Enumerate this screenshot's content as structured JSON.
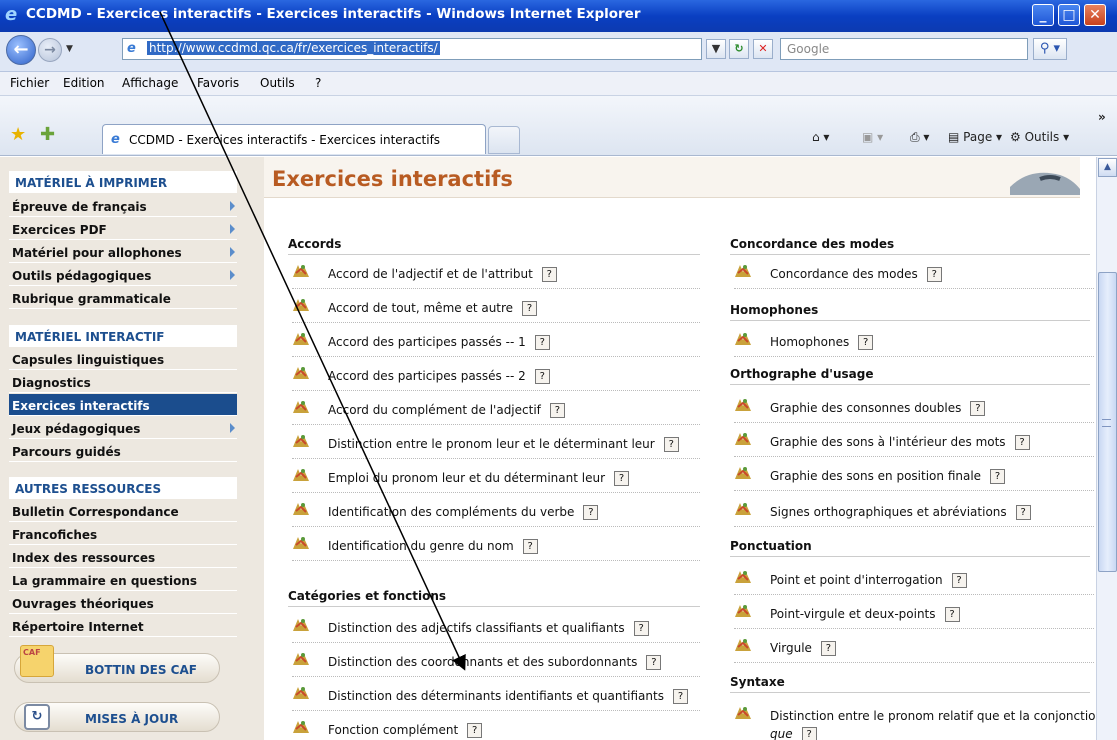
{
  "window": {
    "title": "CCDMD - Exercices interactifs - Exercices interactifs - Windows Internet Explorer"
  },
  "address": {
    "url": "http://www.ccdmd.qc.ca/fr/exercices_interactifs/",
    "search_placeholder": "Google"
  },
  "menu": [
    "Fichier",
    "Edition",
    "Affichage",
    "Favoris",
    "Outils",
    "?"
  ],
  "tab": {
    "title": "CCDMD - Exercices interactifs - Exercices interactifs"
  },
  "commands": {
    "page": "Page",
    "tools": "Outils",
    "more": "»"
  },
  "sidebar": {
    "print_header": "MATÉRIEL À IMPRIMER",
    "print_items": [
      "Épreuve de français",
      "Exercices PDF",
      "Matériel pour allophones",
      "Outils pédagogiques",
      "Rubrique grammaticale"
    ],
    "interactive_header": "MATÉRIEL INTERACTIF",
    "interactive_items": [
      "Capsules linguistiques",
      "Diagnostics",
      "Exercices interactifs",
      "Jeux pédagogiques",
      "Parcours guidés"
    ],
    "other_header": "AUTRES RESSOURCES",
    "other_items": [
      "Bulletin Correspondance",
      "Francofiches",
      "Index des ressources",
      "La grammaire en questions",
      "Ouvrages théoriques",
      "Répertoire Internet"
    ],
    "caf_label": "CAF",
    "bottin": "BOTTIN DES CAF",
    "maj": "MISES À JOUR"
  },
  "main": {
    "title": "Exercices interactifs",
    "help": "?",
    "left": {
      "cat1": "Accords",
      "cat1_items": [
        "Accord de l'adjectif et de l'attribut",
        "Accord de tout, même et autre",
        "Accord des participes passés -- 1",
        "Accord des participes passés -- 2",
        "Accord du complément de l'adjectif",
        "Distinction entre le pronom leur et le déterminant leur",
        "Emploi du pronom leur et du déterminant leur",
        "Identification des compléments du verbe",
        "Identification du genre du nom"
      ],
      "cat2": "Catégories et fonctions",
      "cat2_items": [
        "Distinction des adjectifs classifiants et qualifiants",
        "Distinction des coordonnants et des subordonnants",
        "Distinction des déterminants identifiants et quantifiants",
        "Fonction complément"
      ]
    },
    "right": {
      "cat1": "Concordance des modes",
      "cat1_items": [
        "Concordance des modes"
      ],
      "cat2": "Homophones",
      "cat2_items": [
        "Homophones"
      ],
      "cat3": "Orthographe d'usage",
      "cat3_items": [
        "Graphie des consonnes doubles",
        "Graphie des sons à l'intérieur des mots",
        "Graphie des sons en position finale",
        "Signes orthographiques et abréviations"
      ],
      "cat4": "Ponctuation",
      "cat4_items": [
        "Point et point d'interrogation",
        "Point-virgule et deux-points",
        "Virgule"
      ],
      "cat5": "Syntaxe",
      "cat5_items": [
        "Distinction entre le pronom relatif que et la conjonction",
        "que"
      ]
    }
  }
}
